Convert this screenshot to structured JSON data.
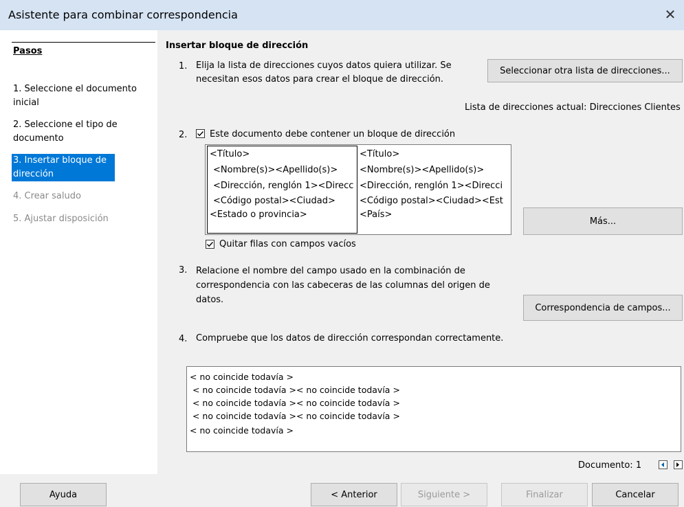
{
  "window": {
    "title": "Asistente para combinar correspondencia",
    "close_icon": "close-icon"
  },
  "sidebar": {
    "heading": "Pasos",
    "steps": [
      {
        "label": "1. Seleccione el documento inicial",
        "state": "normal"
      },
      {
        "label": "2. Seleccione el tipo de documento",
        "state": "normal"
      },
      {
        "label": "3. Insertar bloque de dirección",
        "state": "selected"
      },
      {
        "label": "4. Crear saludo",
        "state": "disabled"
      },
      {
        "label": "5. Ajustar disposición",
        "state": "disabled"
      }
    ]
  },
  "main": {
    "heading": "Insertar bloque de dirección",
    "step1": {
      "number": "1.",
      "text": "Elija la lista de direcciones cuyos datos quiera utilizar. Se necesitan esos datos para crear el bloque de dirección.",
      "button": "Seleccionar otra lista de direcciones...",
      "current_list": "Lista de direcciones actual: Direcciones Clientes"
    },
    "step2": {
      "number": "2.",
      "checkbox_label": "Este documento debe contener un bloque de dirección",
      "checked": true,
      "block_left": [
        "<Título>",
        "<Nombre(s)><Apellido(s)>",
        "<Dirección, renglón 1><Direcc",
        "<Código postal><Ciudad>",
        "<Estado o provincia>"
      ],
      "block_right": [
        "<Título>",
        "<Nombre(s)><Apellido(s)>",
        "<Dirección, renglón 1><Direcci",
        "<Código postal><Ciudad><Est",
        "<País>"
      ],
      "more_button": "Más...",
      "remove_empty_label": "Quitar filas con campos vacíos",
      "remove_empty_checked": true
    },
    "step3": {
      "number": "3.",
      "text": "Relacione el nombre del campo usado en la combinación de correspondencia con las cabeceras de las columnas del origen de datos.",
      "button": "Correspondencia de campos..."
    },
    "step4": {
      "number": "4.",
      "text": "Compruebe que los datos de dirección correspondan correctamente.",
      "preview_lines": [
        "< no coincide todavía >",
        " < no coincide todavía >< no coincide todavía >",
        " < no coincide todavía >< no coincide todavía >",
        " < no coincide todavía >< no coincide todavía >",
        "< no coincide todavía >"
      ],
      "document_label": "Documento: 1"
    }
  },
  "footer": {
    "help": "Ayuda",
    "previous": "< Anterior",
    "next": "Siguiente >",
    "finish": "Finalizar",
    "cancel": "Cancelar"
  }
}
